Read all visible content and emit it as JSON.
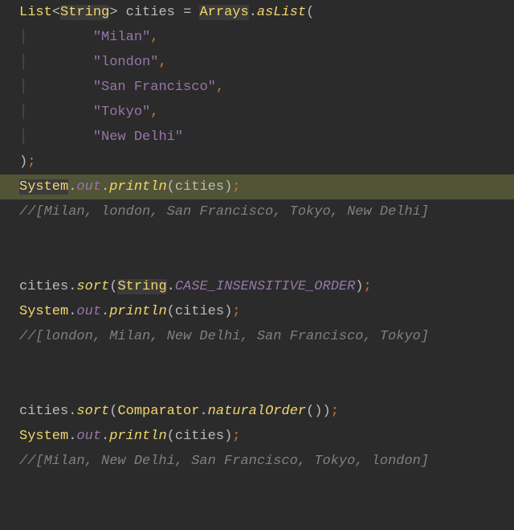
{
  "code": {
    "line1": {
      "type_list": "List",
      "lt": "<",
      "type_string": "String",
      "gt": ">",
      "sp1": " ",
      "var": "cities",
      "sp2": " ",
      "eq": "=",
      "sp3": " ",
      "arrays": "Arrays",
      "dot": ".",
      "aslist": "asList",
      "lparen": "("
    },
    "indent": "        ",
    "guide": "│",
    "strings": {
      "milan": "\"Milan\"",
      "london": "\"london\"",
      "sanfran": "\"San Francisco\"",
      "tokyo": "\"Tokyo\"",
      "newdelhi": "\"New Delhi\""
    },
    "comma": ",",
    "line_close": {
      "rparen": ")",
      "semi": ";"
    },
    "println": {
      "system": "System",
      "dot1": ".",
      "out": "out",
      "dot2": ".",
      "println": "println",
      "lparen": "(",
      "arg": "cities",
      "rparen": ")",
      "semi": ";"
    },
    "comment1": "//[Milan, london, San Francisco, Tokyo, New Delhi]",
    "sort1": {
      "cities": "cities",
      "dot": ".",
      "sort": "sort",
      "lparen": "(",
      "string": "String",
      "dot2": ".",
      "cio": "CASE_INSENSITIVE_ORDER",
      "rparen": ")",
      "semi": ";"
    },
    "comment2": "//[london, Milan, New Delhi, San Francisco, Tokyo]",
    "sort2": {
      "cities": "cities",
      "dot": ".",
      "sort": "sort",
      "lparen": "(",
      "comparator": "Comparator",
      "dot2": ".",
      "natural": "naturalOrder",
      "lparen2": "(",
      "rparen2": ")",
      "rparen": ")",
      "semi": ";"
    },
    "comment3": "//[Milan, New Delhi, San Francisco, Tokyo, london]"
  }
}
